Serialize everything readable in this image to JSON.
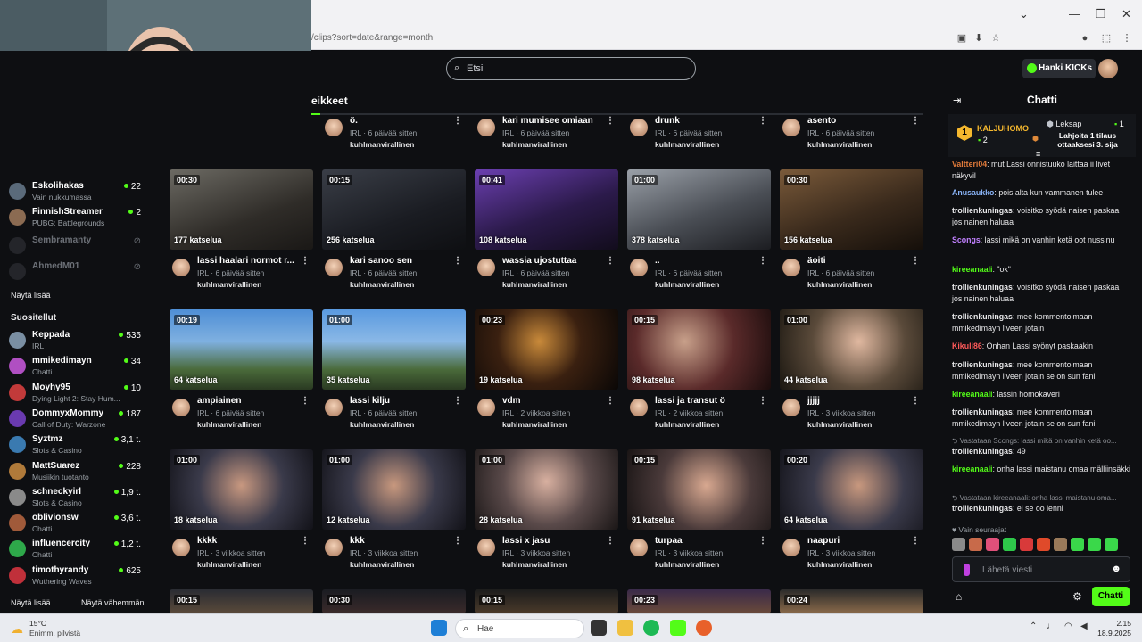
{
  "browser": {
    "url": "/clips?sort=date&range=month",
    "win_min": "⌄",
    "win_minimize": "—",
    "win_restore": "❐",
    "win_close": "✕"
  },
  "header": {
    "search_placeholder": "Etsi",
    "kicks_label": "Hanki KICKs",
    "section_title": "eikkeet"
  },
  "sidebar": {
    "followed": [
      {
        "name": "Eskolihakas",
        "sub": "Vain nukkumassa",
        "count": "22",
        "live": true,
        "color": "#5a6a7a"
      },
      {
        "name": "FinnishStreamer",
        "sub": "PUBG: Battlegrounds",
        "count": "2",
        "live": true,
        "color": "#8b6b52"
      },
      {
        "name": "Sembramanty",
        "sub": "",
        "count": "",
        "live": false,
        "color": "#444"
      },
      {
        "name": "AhmedM01",
        "sub": "",
        "count": "",
        "live": false,
        "color": "#444"
      }
    ],
    "show_more": "Näytä lisää",
    "recommended_heading": "Suositellut",
    "recommended": [
      {
        "name": "Keppada",
        "sub": "IRL",
        "count": "535",
        "color": "#7a8fa3"
      },
      {
        "name": "mmikedimayn",
        "sub": "Chatti",
        "count": "34",
        "color": "#b04fc2"
      },
      {
        "name": "Moyhy95",
        "sub": "Dying Light 2: Stay Hum...",
        "count": "10",
        "color": "#c23a3a"
      },
      {
        "name": "DommyxMommy",
        "sub": "Call of Duty: Warzone",
        "count": "187",
        "color": "#6a3ab0"
      },
      {
        "name": "Syztmz",
        "sub": "Slots & Casino",
        "count": "3,1 t.",
        "color": "#3a7ab0"
      },
      {
        "name": "MattSuarez",
        "sub": "Musiikin tuotanto",
        "count": "228",
        "color": "#b07a3a"
      },
      {
        "name": "schneckyirl",
        "sub": "Slots & Casino",
        "count": "1,9 t.",
        "color": "#8a8a8a"
      },
      {
        "name": "oblivionsw",
        "sub": "Chatti",
        "count": "3,6 t.",
        "color": "#a05a3a"
      },
      {
        "name": "influencercity",
        "sub": "Chatti",
        "count": "1,2 t.",
        "color": "#2ea84a"
      },
      {
        "name": "timothyrandy",
        "sub": "Wuthering Waves",
        "count": "625",
        "color": "#c0303a"
      }
    ],
    "show_more_bottom": "Näytä lisää",
    "show_less": "Näytä vähemmän"
  },
  "clips_top_partial": [
    {
      "title": "ö.",
      "sub": "IRL · 6 päivää sitten",
      "channel": "kuhlmanvirallinen"
    },
    {
      "title": "kari mumisee omiaan",
      "sub": "IRL · 6 päivää sitten",
      "channel": "kuhlmanvirallinen"
    },
    {
      "title": "drunk",
      "sub": "IRL · 6 päivää sitten",
      "channel": "kuhlmanvirallinen"
    },
    {
      "title": "asento",
      "sub": "IRL · 6 päivää sitten",
      "channel": "kuhlmanvirallinen"
    }
  ],
  "clips": [
    {
      "duration": "00:30",
      "views": "177 katselua",
      "title": "lassi haalari normot r...",
      "sub": "IRL · 6 päivää sitten",
      "channel": "kuhlmanvirallinen",
      "bg": "linear-gradient(160deg,#6c6a63,#2f2c28 60%,#1a1816)"
    },
    {
      "duration": "00:15",
      "views": "256 katselua",
      "title": "kari sanoo sen",
      "sub": "IRL · 6 päivää sitten",
      "channel": "kuhlmanvirallinen",
      "bg": "linear-gradient(160deg,#3a3e47,#1a1c22 60%,#0e0f12)"
    },
    {
      "duration": "00:41",
      "views": "108 katselua",
      "title": "wassia ujostuttaa",
      "sub": "IRL · 6 päivää sitten",
      "channel": "kuhlmanvirallinen",
      "bg": "linear-gradient(160deg,#6b3fb0,#2b1a4a 55%,#120c1c)"
    },
    {
      "duration": "01:00",
      "views": "378 katselua",
      "title": "..",
      "sub": "IRL · 6 päivää sitten",
      "channel": "kuhlmanvirallinen",
      "bg": "linear-gradient(160deg,#9aa0a8,#4a4e55 55%,#1c1d21)"
    },
    {
      "duration": "00:30",
      "views": "156 katselua",
      "title": "äoiti",
      "sub": "IRL · 6 päivää sitten",
      "channel": "kuhlmanvirallinen",
      "bg": "linear-gradient(160deg,#7a5a3a,#3a2a1c 55%,#150f0a)"
    },
    {
      "duration": "00:19",
      "views": "64 katselua",
      "title": "ampiainen",
      "sub": "IRL · 6 päivää sitten",
      "channel": "kuhlmanvirallinen",
      "bg": "linear-gradient(180deg,#4f8fd6,#7fb0e0 40%,#4a6a3a 75%,#2a3a22)"
    },
    {
      "duration": "01:00",
      "views": "35 katselua",
      "title": "lassi kilju",
      "sub": "IRL · 6 päivää sitten",
      "channel": "kuhlmanvirallinen",
      "bg": "linear-gradient(180deg,#5a9ae0,#8ab8e6 40%,#4a6a3a 75%,#2a3a22)"
    },
    {
      "duration": "00:23",
      "views": "19 katselua",
      "title": "vdm",
      "sub": "IRL · 2 viikkoa sitten",
      "channel": "kuhlmanvirallinen",
      "bg": "radial-gradient(circle at 45% 40%,#c98a3a,#3a2010 45%,#0a0706)"
    },
    {
      "duration": "00:15",
      "views": "98 katselua",
      "title": "lassi ja transut ö",
      "sub": "IRL · 2 viikkoa sitten",
      "channel": "kuhlmanvirallinen",
      "bg": "radial-gradient(circle at 40% 40%,#c8a08a,#5a2a2a 50%,#1a0c0c)"
    },
    {
      "duration": "01:00",
      "views": "44 katselua",
      "title": "jjjjj",
      "sub": "IRL · 3 viikkoa sitten",
      "channel": "kuhlmanvirallinen",
      "bg": "radial-gradient(circle at 55% 40%,#e0b8a0,#5a4a3a 50%,#1a1610)"
    },
    {
      "duration": "01:00",
      "views": "18 katselua",
      "title": "kkkk",
      "sub": "IRL · 3 viikkoa sitten",
      "channel": "kuhlmanvirallinen",
      "bg": "radial-gradient(circle at 50% 45%,#c89880,#3a3a4a 50%,#121218)"
    },
    {
      "duration": "01:00",
      "views": "12 katselua",
      "title": "kkk",
      "sub": "IRL · 3 viikkoa sitten",
      "channel": "kuhlmanvirallinen",
      "bg": "radial-gradient(circle at 50% 45%,#c8987e,#3a3a4a 50%,#121218)"
    },
    {
      "duration": "01:00",
      "views": "28 katselua",
      "title": "lassi x jasu",
      "sub": "IRL · 3 viikkoa sitten",
      "channel": "kuhlmanvirallinen",
      "bg": "radial-gradient(circle at 50% 40%,#d8b0a0,#5a4a4a 50%,#1a1616)"
    },
    {
      "duration": "00:15",
      "views": "91 katselua",
      "title": "turpaa",
      "sub": "IRL · 3 viikkoa sitten",
      "channel": "kuhlmanvirallinen",
      "bg": "radial-gradient(circle at 55% 45%,#d8a890,#4a3a3a 50%,#161212)"
    },
    {
      "duration": "00:20",
      "views": "64 katselua",
      "title": "naapuri",
      "sub": "IRL · 3 viikkoa sitten",
      "channel": "kuhlmanvirallinen",
      "bg": "radial-gradient(circle at 55% 45%,#c8987e,#3a3a4a 50%,#121218)"
    },
    {
      "duration": "00:15",
      "views": "",
      "title": "",
      "sub": "",
      "channel": "",
      "bg": "linear-gradient(180deg,#2a2c33,#5a4a3a)"
    },
    {
      "duration": "00:30",
      "views": "",
      "title": "",
      "sub": "",
      "channel": "",
      "bg": "linear-gradient(180deg,#1a1c22,#3a2a2a)"
    },
    {
      "duration": "00:15",
      "views": "",
      "title": "",
      "sub": "",
      "channel": "",
      "bg": "linear-gradient(180deg,#1c1c1c,#4a3a2a)"
    },
    {
      "duration": "00:23",
      "views": "",
      "title": "",
      "sub": "",
      "channel": "",
      "bg": "linear-gradient(180deg,#3a2a4a,#6a4a3a)"
    },
    {
      "duration": "00:24",
      "views": "",
      "title": "",
      "sub": "",
      "channel": "",
      "bg": "linear-gradient(180deg,#2a2a2a,#8a6a4a)"
    }
  ],
  "chat": {
    "title": "Chatti",
    "pinned": {
      "leader_name": "KALJUHOMO",
      "leader_count": "2",
      "second_name": "Leksap",
      "second_count": "1",
      "cta": "Lahjoita 1 tilaus ottaaksesi 3. sija"
    },
    "messages": [
      {
        "user": "Valtteri04",
        "color": "#e07a3a",
        "text": "mut Lassi onnistuuko laittaa ii livet näkyvil"
      },
      {
        "user": "Anusaukko",
        "color": "#8ab4f8",
        "text": "pois alta kun vammanen tulee"
      },
      {
        "user": "trollienkuningas",
        "color": "#e8e8ea",
        "text": "voisitko syödä naisen paskaa jos nainen haluaa"
      },
      {
        "user": "Scongs",
        "color": "#c080ff",
        "text": "lassi mikä on vanhin ketä oot nussinu"
      },
      {
        "user": "kireeanaali",
        "color": "#53fc18",
        "text": "\"ok\""
      },
      {
        "user": "trollienkuningas",
        "color": "#e8e8ea",
        "text": "voisitko syödä naisen paskaa jos nainen haluaa"
      },
      {
        "user": "trollienkuningas",
        "color": "#e8e8ea",
        "text": "mee kommentoimaan mmikedimayn liveen jotain"
      },
      {
        "user": "Kikuli86",
        "color": "#ff5a5a",
        "text": "Onhan Lassi syönyt paskaakin"
      },
      {
        "user": "trollienkuningas",
        "color": "#e8e8ea",
        "text": "mee kommentoimaan mmikedimayn liveen jotain se on sun fani"
      },
      {
        "user": "kireeanaali",
        "color": "#53fc18",
        "text": "lassin homokaveri"
      },
      {
        "user": "trollienkuningas",
        "color": "#e8e8ea",
        "text": "mee kommentoimaan mmikedimayn liveen jotain se on sun fani"
      },
      {
        "reply": "Vastataan Scongs: lassi mikä on vanhin ketä oo..."
      },
      {
        "user": "trollienkuningas",
        "color": "#e8e8ea",
        "text": "49"
      },
      {
        "user": "kireeanaali",
        "color": "#53fc18",
        "text": "onha lassi maistanu omaa mälliinsäkki"
      },
      {
        "reply": "Vastataan kireeanaali: onha lassi maistanu oma..."
      },
      {
        "user": "trollienkuningas",
        "color": "#e8e8ea",
        "text": "ei se oo lenni"
      }
    ],
    "followers_only": "Vain seuraajat",
    "input_placeholder": "Lähetä viesti",
    "send_label": "Chatti"
  },
  "taskbar": {
    "weather_temp": "15°C",
    "weather_desc": "Enimm. pilvistä",
    "search_placeholder": "Hae",
    "time": "2.15",
    "date": "18.9.2025"
  }
}
